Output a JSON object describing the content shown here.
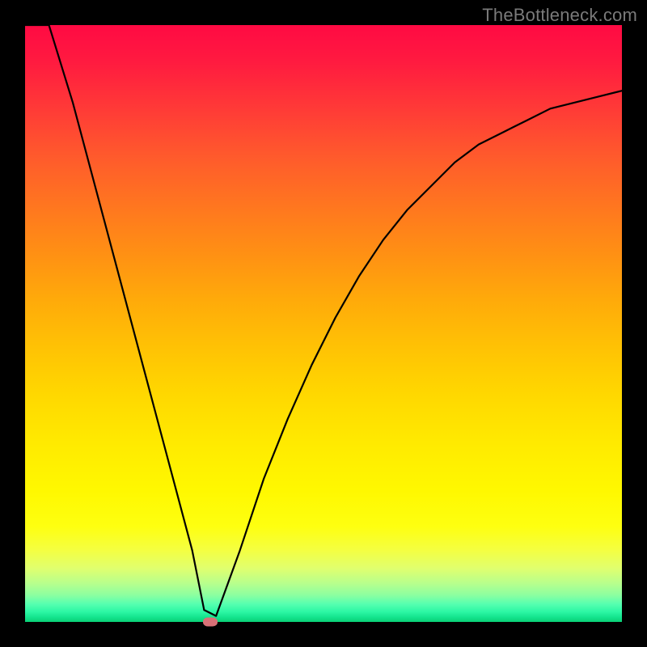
{
  "watermark": "TheBottleneck.com",
  "chart_data": {
    "type": "line",
    "title": "",
    "xlabel": "",
    "ylabel": "",
    "xlim": [
      0,
      100
    ],
    "ylim": [
      0,
      100
    ],
    "grid": false,
    "legend": false,
    "x": [
      0,
      4,
      8,
      12,
      16,
      20,
      24,
      28,
      30,
      32,
      36,
      40,
      44,
      48,
      52,
      56,
      60,
      64,
      68,
      72,
      76,
      80,
      84,
      88,
      92,
      96,
      100
    ],
    "values": [
      118,
      102,
      87,
      72,
      57,
      42,
      27,
      12,
      2,
      1,
      12,
      24,
      34,
      43,
      51,
      58,
      64,
      69,
      73,
      77,
      80,
      82,
      84,
      86,
      87,
      88,
      89
    ],
    "min_point": {
      "x": 31,
      "y": 0
    },
    "background": "rainbow-vertical"
  },
  "colors": {
    "curve": "#000000",
    "marker": "#d87076",
    "frame": "#000000"
  }
}
